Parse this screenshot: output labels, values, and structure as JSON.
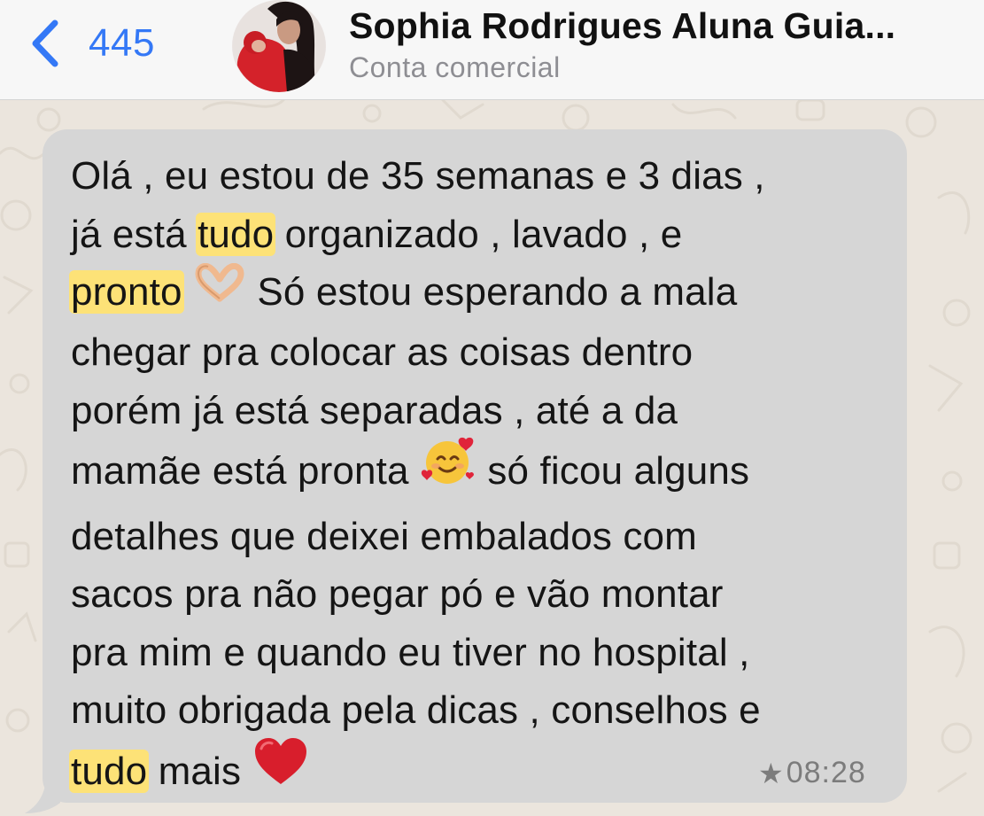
{
  "header": {
    "back_count": "445",
    "contact_name": "Sophia Rodrigues Aluna Guia...",
    "contact_subtitle": "Conta comercial"
  },
  "message": {
    "lines": [
      [
        {
          "t": "Olá , eu estou de 35 semanas e 3 dias ,"
        }
      ],
      [
        {
          "t": "já está "
        },
        {
          "t": "tudo",
          "hl": true
        },
        {
          "t": " organizado , lavado , e"
        }
      ],
      [
        {
          "t": "pronto",
          "hl": true
        },
        {
          "t": " "
        },
        {
          "emoji": "heart-hands-emoji"
        },
        {
          "t": "  Só estou esperando a mala"
        }
      ],
      [
        {
          "t": "chegar pra colocar as coisas dentro"
        }
      ],
      [
        {
          "t": "porém já está separadas , até a da"
        }
      ],
      [
        {
          "t": "mamãe está pronta "
        },
        {
          "emoji": "smiling-face-with-hearts-emoji"
        },
        {
          "t": "  só ficou alguns"
        }
      ],
      [
        {
          "t": "detalhes que deixei embalados com"
        }
      ],
      [
        {
          "t": "sacos pra não pegar pó e vão montar"
        }
      ],
      [
        {
          "t": "pra mim e  quando eu tiver no hospital ,"
        }
      ],
      [
        {
          "t": "muito obrigada pela dicas , conselhos e"
        }
      ],
      [
        {
          "t": "tudo",
          "hl": true
        },
        {
          "t": " mais "
        },
        {
          "emoji": "red-heart-emoji"
        }
      ]
    ],
    "starred_icon": "star-icon",
    "time": "08:28"
  },
  "colors": {
    "accent": "#3478f6",
    "highlight": "#fde277",
    "bubble": "#d6d6d6",
    "chat_background": "#ebe5dd"
  }
}
